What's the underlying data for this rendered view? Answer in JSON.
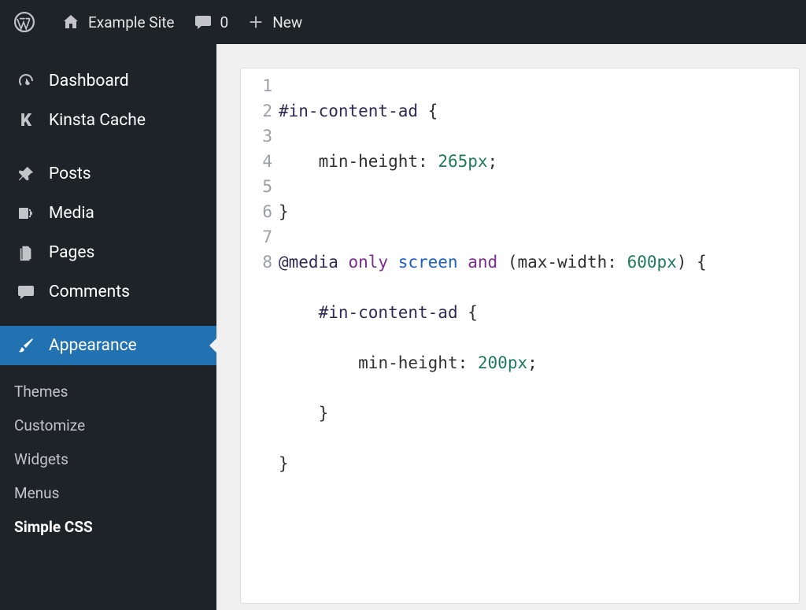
{
  "adminbar": {
    "site_name": "Example Site",
    "comments_count": "0",
    "new_label": "New"
  },
  "sidebar": {
    "main": [
      {
        "id": "dashboard",
        "label": "Dashboard",
        "icon": "gauge"
      },
      {
        "id": "kinsta-cache",
        "label": "Kinsta Cache",
        "icon": "k"
      },
      {
        "id": "posts",
        "label": "Posts",
        "icon": "pin"
      },
      {
        "id": "media",
        "label": "Media",
        "icon": "media"
      },
      {
        "id": "pages",
        "label": "Pages",
        "icon": "pages"
      },
      {
        "id": "comments",
        "label": "Comments",
        "icon": "comment"
      },
      {
        "id": "appearance",
        "label": "Appearance",
        "icon": "brush",
        "current": true
      }
    ],
    "appearance_submenu": [
      {
        "id": "themes",
        "label": "Themes"
      },
      {
        "id": "customize",
        "label": "Customize"
      },
      {
        "id": "widgets",
        "label": "Widgets"
      },
      {
        "id": "menus",
        "label": "Menus"
      },
      {
        "id": "simple-css",
        "label": "Simple CSS",
        "current": true
      }
    ]
  },
  "editor": {
    "line_count": 8,
    "lines": {
      "l1": {
        "sel": "#in-content-ad",
        "brace": " {"
      },
      "l2": {
        "indent": "    ",
        "prop": "min-height",
        "colon": ": ",
        "value": "265px",
        "semi": ";"
      },
      "l3": {
        "brace": "}"
      },
      "l4": {
        "at": "@media",
        "only": " only",
        "screen": " screen",
        "and": " and",
        "open": " (",
        "prop": "max-width",
        "colon": ": ",
        "value": "600px",
        "close": ") {"
      },
      "l5": {
        "indent": "    ",
        "sel": "#in-content-ad",
        "brace": " {"
      },
      "l6": {
        "indent": "        ",
        "prop": "min-height",
        "colon": ": ",
        "value": "200px",
        "semi": ";"
      },
      "l7": {
        "indent": "    ",
        "brace": "}"
      },
      "l8": {
        "brace": "}"
      }
    }
  }
}
